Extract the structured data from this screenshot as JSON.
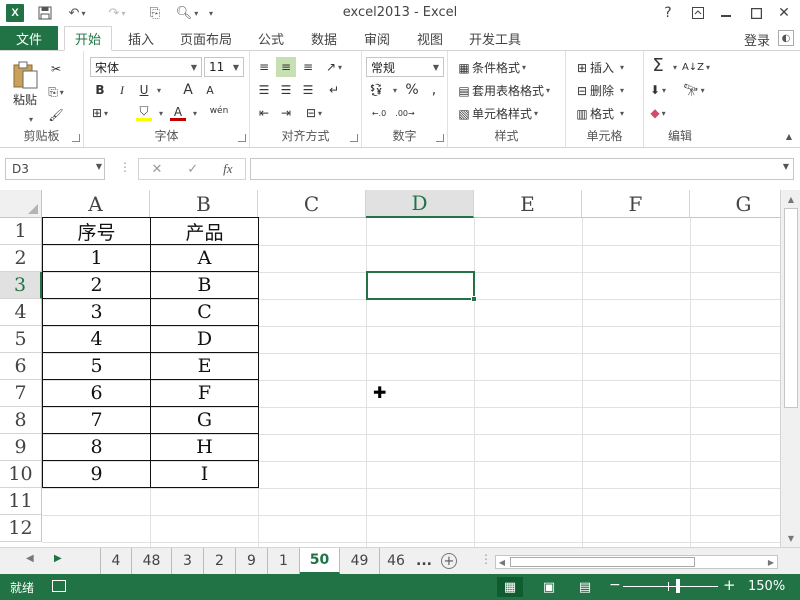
{
  "window": {
    "app_logo": "X",
    "title": "excel2013 - Excel",
    "help_label": "?",
    "ribbon_options_icon": "ribbon-display-options-icon",
    "minimize_icon": "minimize-icon",
    "maximize_icon": "maximize-icon",
    "close_icon": "close-icon"
  },
  "ribbon_tabs": {
    "file": "文件",
    "tabs": [
      "开始",
      "插入",
      "页面布局",
      "公式",
      "数据",
      "审阅",
      "视图",
      "开发工具"
    ],
    "active": "开始",
    "login": "登录"
  },
  "ribbon": {
    "clipboard": {
      "label": "剪贴板",
      "paste": "粘贴"
    },
    "font": {
      "label": "字体",
      "name": "宋体",
      "size": "11",
      "bold": "B",
      "italic": "I",
      "underline": "U",
      "grow": "A",
      "shrink": "A",
      "phonetic": "wén"
    },
    "alignment": {
      "label": "对齐方式"
    },
    "number": {
      "label": "数字",
      "format": "常规",
      "percent": "%"
    },
    "styles": {
      "label": "样式",
      "conditional": "条件格式",
      "table": "套用表格格式",
      "cell": "单元格样式"
    },
    "cells": {
      "label": "单元格",
      "insert": "插入",
      "delete": "删除",
      "format": "格式"
    },
    "editing": {
      "label": "编辑"
    }
  },
  "formula_bar": {
    "name_box": "D3",
    "fx": "fx",
    "formula": ""
  },
  "sheet": {
    "columns": [
      "A",
      "B",
      "C",
      "D",
      "E",
      "F",
      "G"
    ],
    "selected_column": "D",
    "rows": [
      "1",
      "2",
      "3",
      "4",
      "5",
      "6",
      "7",
      "8",
      "9",
      "10",
      "11",
      "12"
    ],
    "selected_row": "3",
    "headers": [
      "序号",
      "产品"
    ],
    "data": [
      [
        "1",
        "A"
      ],
      [
        "2",
        "B"
      ],
      [
        "3",
        "C"
      ],
      [
        "4",
        "D"
      ],
      [
        "5",
        "E"
      ],
      [
        "6",
        "F"
      ],
      [
        "7",
        "G"
      ],
      [
        "8",
        "H"
      ],
      [
        "9",
        "I"
      ]
    ]
  },
  "sheet_tabs": {
    "tabs": [
      "4",
      "48",
      "3",
      "2",
      "9",
      "1",
      "50",
      "49",
      "46"
    ],
    "active": "50",
    "more": "..."
  },
  "status_bar": {
    "status": "就绪",
    "zoom": "150%"
  },
  "colors": {
    "accent": "#217346",
    "grid": "#e1e1e1"
  }
}
